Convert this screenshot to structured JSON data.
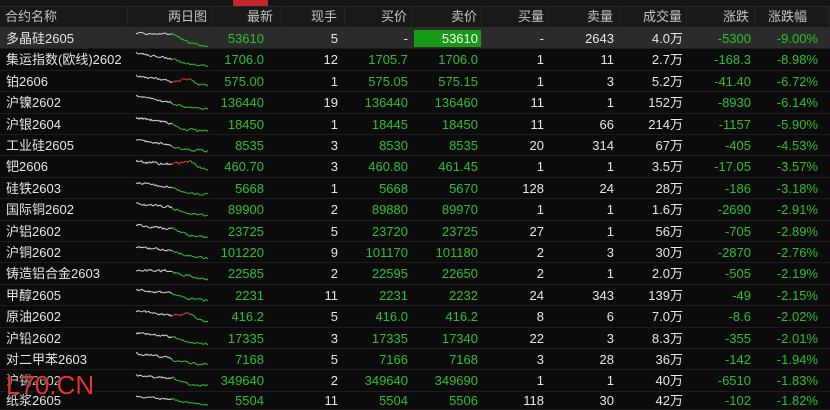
{
  "columns": {
    "name": "合约名称",
    "chart": "两日图",
    "last": "最新",
    "lot": "现手",
    "bid": "买价",
    "ask": "卖价",
    "bid_vol": "买量",
    "ask_vol": "卖量",
    "volume": "成交量",
    "chg": "涨跌",
    "chg_pct": "涨跌幅"
  },
  "rows": [
    {
      "name": "多晶硅2605",
      "last": "53610",
      "lot": "5",
      "bid": "-",
      "ask": "53610",
      "bid_vol": "-",
      "ask_vol": "2643",
      "volume": "4.0万",
      "chg": "-5300",
      "chg_pct": "-9.00%",
      "selected": true,
      "ask_highlight": true,
      "spark_up": false
    },
    {
      "name": "集运指数(欧线)2602",
      "last": "1706.0",
      "lot": "12",
      "bid": "1705.7",
      "ask": "1706.0",
      "bid_vol": "1",
      "ask_vol": "11",
      "volume": "2.7万",
      "chg": "-168.3",
      "chg_pct": "-8.98%",
      "spark_up": false
    },
    {
      "name": "铂2606",
      "last": "575.00",
      "lot": "1",
      "bid": "575.05",
      "ask": "575.15",
      "bid_vol": "1",
      "ask_vol": "3",
      "volume": "5.2万",
      "chg": "-41.40",
      "chg_pct": "-6.72%",
      "spark_up": true
    },
    {
      "name": "沪镍2602",
      "last": "136440",
      "lot": "19",
      "bid": "136440",
      "ask": "136460",
      "bid_vol": "11",
      "ask_vol": "1",
      "volume": "152万",
      "chg": "-8930",
      "chg_pct": "-6.14%",
      "spark_up": false
    },
    {
      "name": "沪银2604",
      "last": "18450",
      "lot": "1",
      "bid": "18445",
      "ask": "18450",
      "bid_vol": "11",
      "ask_vol": "66",
      "volume": "214万",
      "chg": "-1157",
      "chg_pct": "-5.90%",
      "spark_up": false
    },
    {
      "name": "工业硅2605",
      "last": "8535",
      "lot": "3",
      "bid": "8530",
      "ask": "8535",
      "bid_vol": "20",
      "ask_vol": "314",
      "volume": "67万",
      "chg": "-405",
      "chg_pct": "-4.53%",
      "spark_up": false
    },
    {
      "name": "钯2606",
      "last": "460.70",
      "lot": "3",
      "bid": "460.80",
      "ask": "461.45",
      "bid_vol": "1",
      "ask_vol": "1",
      "volume": "3.5万",
      "chg": "-17.05",
      "chg_pct": "-3.57%",
      "spark_up": true
    },
    {
      "name": "硅铁2603",
      "last": "5668",
      "lot": "1",
      "bid": "5668",
      "ask": "5670",
      "bid_vol": "128",
      "ask_vol": "24",
      "volume": "28万",
      "chg": "-186",
      "chg_pct": "-3.18%",
      "spark_up": false
    },
    {
      "name": "国际铜2602",
      "last": "89900",
      "lot": "2",
      "bid": "89880",
      "ask": "89970",
      "bid_vol": "1",
      "ask_vol": "1",
      "volume": "1.6万",
      "chg": "-2690",
      "chg_pct": "-2.91%",
      "spark_up": false
    },
    {
      "name": "沪铝2602",
      "last": "23725",
      "lot": "5",
      "bid": "23720",
      "ask": "23725",
      "bid_vol": "27",
      "ask_vol": "1",
      "volume": "56万",
      "chg": "-705",
      "chg_pct": "-2.89%",
      "spark_up": false
    },
    {
      "name": "沪铜2602",
      "last": "101220",
      "lot": "9",
      "bid": "101170",
      "ask": "101180",
      "bid_vol": "2",
      "ask_vol": "3",
      "volume": "30万",
      "chg": "-2870",
      "chg_pct": "-2.76%",
      "spark_up": false
    },
    {
      "name": "铸造铝合金2603",
      "last": "22585",
      "lot": "2",
      "bid": "22595",
      "ask": "22650",
      "bid_vol": "2",
      "ask_vol": "1",
      "volume": "2.0万",
      "chg": "-505",
      "chg_pct": "-2.19%",
      "spark_up": false
    },
    {
      "name": "甲醇2605",
      "last": "2231",
      "lot": "11",
      "bid": "2231",
      "ask": "2232",
      "bid_vol": "24",
      "ask_vol": "343",
      "volume": "139万",
      "chg": "-49",
      "chg_pct": "-2.15%",
      "spark_up": false
    },
    {
      "name": "原油2602",
      "last": "416.2",
      "lot": "5",
      "bid": "416.0",
      "ask": "416.2",
      "bid_vol": "8",
      "ask_vol": "6",
      "volume": "7.0万",
      "chg": "-8.6",
      "chg_pct": "-2.02%",
      "spark_up": true
    },
    {
      "name": "沪铅2602",
      "last": "17335",
      "lot": "3",
      "bid": "17335",
      "ask": "17340",
      "bid_vol": "22",
      "ask_vol": "3",
      "volume": "8.3万",
      "chg": "-355",
      "chg_pct": "-2.01%",
      "spark_up": false
    },
    {
      "name": "对二甲苯2603",
      "last": "7168",
      "lot": "5",
      "bid": "7166",
      "ask": "7168",
      "bid_vol": "3",
      "ask_vol": "28",
      "volume": "36万",
      "chg": "-142",
      "chg_pct": "-1.94%",
      "spark_up": false
    },
    {
      "name": "沪锡2602",
      "last": "349640",
      "lot": "2",
      "bid": "349640",
      "ask": "349690",
      "bid_vol": "1",
      "ask_vol": "1",
      "volume": "40万",
      "chg": "-6510",
      "chg_pct": "-1.83%",
      "spark_up": false
    },
    {
      "name": "纸浆2605",
      "last": "5504",
      "lot": "11",
      "bid": "5504",
      "ask": "5506",
      "bid_vol": "118",
      "ask_vol": "30",
      "volume": "42万",
      "chg": "-102",
      "chg_pct": "-1.82%",
      "spark_up": false
    }
  ],
  "colors": {
    "background": "#0b0b0b",
    "text": "#e6e6e6",
    "down": "#2dc02d",
    "up": "#e03a3a",
    "prev_day_line": "#d4d4d4",
    "selected_row": "#2b2b2b",
    "ask_box": "#179b17",
    "ask_box_text": "#ffffff",
    "active_tab": "#c0282a",
    "watermark": "#e8322a"
  },
  "watermark": "L70.CN"
}
